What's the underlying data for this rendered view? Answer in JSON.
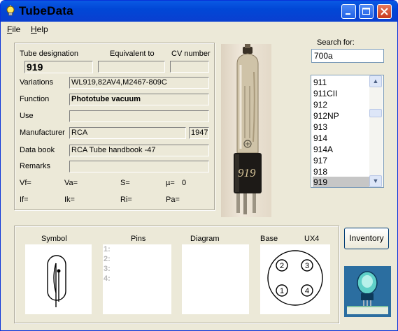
{
  "window": {
    "title": "TubeData"
  },
  "menu": [
    {
      "accel": "F",
      "rest": "ile"
    },
    {
      "accel": "H",
      "rest": "elp"
    }
  ],
  "labels": {
    "tube_designation": "Tube designation",
    "equivalent_to": "Equivalent to",
    "cv_number": "CV number",
    "variations": "Variations",
    "function": "Function",
    "use": "Use",
    "manufacturer": "Manufacturer",
    "data_book": "Data book",
    "remarks": "Remarks",
    "vf": "Vf=",
    "va": "Va=",
    "s": "S=",
    "mu": "µ=",
    "if": "If=",
    "ik": "Ik=",
    "ri": "Ri=",
    "pa": "Pa=",
    "search_for": "Search for:",
    "symbol": "Symbol",
    "pins": "Pins",
    "diagram": "Diagram",
    "base": "Base",
    "base_type": "UX4"
  },
  "values": {
    "tube_designation": "919",
    "equivalent_to": "",
    "cv_number": "",
    "variations": "WL919,82AV4,M2467-809C",
    "function": "Phototube vacuum",
    "use": "",
    "manufacturer": "RCA",
    "year": "1947",
    "data_book": "RCA Tube handbook -47",
    "remarks": "",
    "mu": "0"
  },
  "search": {
    "value": "700a"
  },
  "tube_list": {
    "items": [
      "911",
      "911CII",
      "912",
      "912NP",
      "913",
      "914",
      "914A",
      "917",
      "918",
      "919"
    ],
    "selected": "919"
  },
  "pins": [
    "1:",
    "2:",
    "3:",
    "4:"
  ],
  "base_pins": [
    "2",
    "3",
    "1",
    "4"
  ],
  "photo_label": "919",
  "buttons": {
    "inventory": "Inventory"
  }
}
